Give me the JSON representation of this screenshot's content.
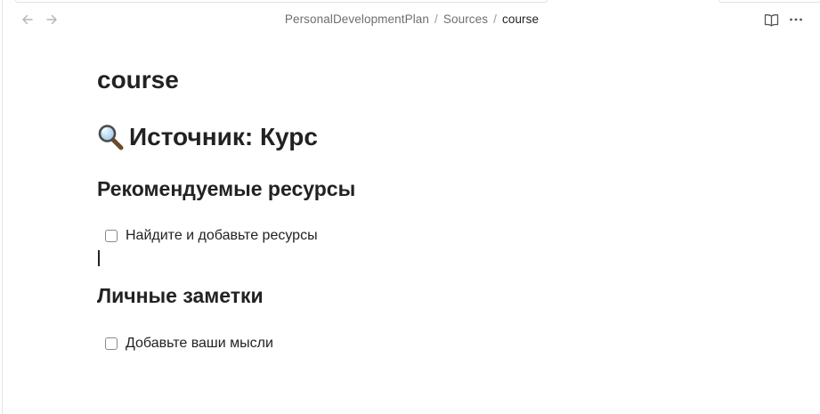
{
  "breadcrumb": {
    "items": [
      "PersonalDevelopmentPlan",
      "Sources",
      "course"
    ],
    "separator": "/"
  },
  "icons": {
    "back": "arrow-left-icon",
    "forward": "arrow-right-icon",
    "reading_view": "book-open-icon",
    "more": "more-options-icon",
    "heading_emoji": "magnifying-glass-icon"
  },
  "note": {
    "title": "course",
    "heading1": "Источник: Курс",
    "sections": [
      {
        "heading": "Рекомендуемые ресурсы",
        "tasks": [
          {
            "label": "Найдите и добавьте ресурсы",
            "checked": false
          }
        ]
      },
      {
        "heading": "Личные заметки",
        "tasks": [
          {
            "label": "Добавьте ваши мысли",
            "checked": false
          }
        ]
      }
    ]
  },
  "colors": {
    "text": "#222222",
    "muted": "#6f6f6f",
    "icon": "#b5b5b5"
  }
}
